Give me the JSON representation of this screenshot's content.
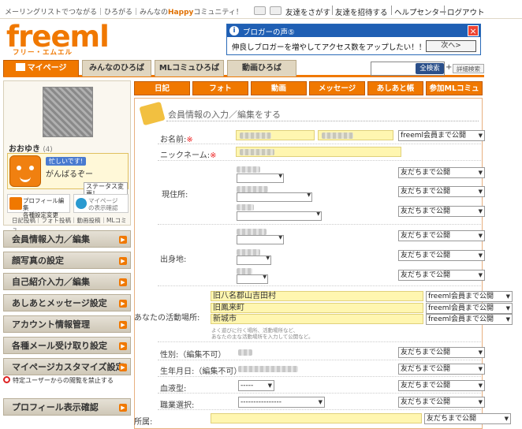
{
  "header": {
    "tagline_a": "メーリングリストでつながる｜ひろがる｜みんなの",
    "tagline_hp": "Happy",
    "tagline_b": "コミュニティ！",
    "links": [
      "友達をさがす",
      "友達を招待する",
      "ヘルプセンター",
      "ログアウト"
    ]
  },
  "logo": {
    "main": "freeml",
    "sub": "フリー・エムエル"
  },
  "ad": {
    "title": "ブロガーの声⑤",
    "message": "伸良しブロガーを増やしてアクセス数をアップしたい！！",
    "next": "次へ>"
  },
  "nav": {
    "tabs": [
      "マイページ",
      "みんなのひろば",
      "MLコミュひろば",
      "動画ひろば"
    ],
    "search_btn": "全検索",
    "plus": "+",
    "advanced": "詳細検索"
  },
  "profile": {
    "name": "おおゆき",
    "count": "(4)",
    "busy": "忙しいです!",
    "status": "がんばるぞー",
    "status_btn": "ステータス変更！",
    "edit_l1": "プロフィール編集",
    "edit_l2": "各種設定変更",
    "view_l1": "マイページ",
    "view_l2": "の表示確認",
    "links": "日記投稿｜フォト投稿｜動画投稿｜MLコミュ"
  },
  "menu": [
    "会員情報入力／編集",
    "顔写真の設定",
    "自己紹介入力／編集",
    "あしあとメッセージ設定",
    "アカウント情報管理",
    "各種メール受け取り設定",
    "マイページカスタマイズ設定"
  ],
  "block_text": "特定ユーザーからの閲覧を禁止する",
  "menu_last": "プロフィール表示確認",
  "subtabs": [
    "日記",
    "フォト",
    "動画",
    "メッセージ",
    "あしあと帳",
    "参加MLコミュ"
  ],
  "form": {
    "title": "会員情報の入力／編集をする",
    "labels": {
      "name": "お名前:",
      "nick": "ニックネーム:",
      "residence": "現住所:",
      "birthplace": "出身地:",
      "activity": "あなたの活動場所:",
      "gender": "性別:（編集不可）",
      "birthday": "生年月日:（編集不可）",
      "blood": "血液型:",
      "job": "職業選択:",
      "belong": "所属:"
    },
    "req": "※",
    "pub_member": "freeml会員まで公開",
    "pub_friends": "友だちまで公開",
    "activity_values": [
      "旧八名郡山吉田村",
      "旧鳳来町",
      "新城市"
    ],
    "activity_note_a": "よく遊びに行く場所、活動場所など、",
    "activity_note_b": "あなたの主な活動場所を入力して公開など。",
    "blood_value": "-----",
    "job_value": "----------------"
  }
}
